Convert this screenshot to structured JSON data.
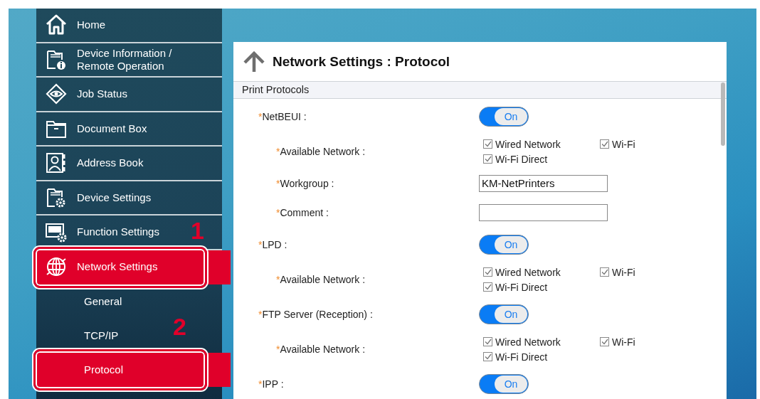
{
  "sidebar": {
    "items": [
      {
        "label": "Home",
        "selected": false,
        "callout": false
      },
      {
        "label": "Device Information / Remote Operation",
        "selected": false,
        "callout": false
      },
      {
        "label": "Job Status",
        "selected": false,
        "callout": false
      },
      {
        "label": "Document Box",
        "selected": false,
        "callout": false
      },
      {
        "label": "Address Book",
        "selected": false,
        "callout": false
      },
      {
        "label": "Device Settings",
        "selected": false,
        "callout": false
      },
      {
        "label": "Function Settings",
        "selected": false,
        "callout": false
      },
      {
        "label": "Network Settings",
        "selected": true,
        "callout": true,
        "children": [
          {
            "label": "General",
            "selected": false,
            "callout": false
          },
          {
            "label": "TCP/IP",
            "selected": false,
            "callout": false
          },
          {
            "label": "Protocol",
            "selected": true,
            "callout": true
          }
        ]
      }
    ]
  },
  "callout_numbers": [
    "1",
    "2"
  ],
  "panel": {
    "title": "Network Settings : Protocol",
    "section": "Print Protocols",
    "protocols": [
      {
        "mark": "*",
        "label": "NetBEUI :",
        "toggle": {
          "label": "On",
          "on": true
        },
        "children": [
          {
            "kind": "checkboxes",
            "mark": "*",
            "label": "Available Network :",
            "options": [
              {
                "label": "Wired Network",
                "checked": true
              },
              {
                "label": "Wi-Fi",
                "checked": true
              },
              {
                "label": "Wi-Fi Direct",
                "checked": true
              }
            ]
          },
          {
            "kind": "text",
            "mark": "*",
            "label": "Workgroup :",
            "value": "KM-NetPrinters"
          },
          {
            "kind": "text",
            "mark": "*",
            "label": "Comment :"
          }
        ]
      },
      {
        "mark": "*",
        "label": "LPD :",
        "toggle": {
          "label": "On",
          "on": true
        },
        "children": [
          {
            "kind": "checkboxes",
            "mark": "*",
            "label": "Available Network :",
            "options": [
              {
                "label": "Wired Network",
                "checked": true
              },
              {
                "label": "Wi-Fi",
                "checked": true
              },
              {
                "label": "Wi-Fi Direct",
                "checked": true
              }
            ]
          }
        ]
      },
      {
        "mark": "*",
        "label": "FTP Server (Reception) :",
        "toggle": {
          "label": "On",
          "on": true
        },
        "children": [
          {
            "kind": "checkboxes",
            "mark": "*",
            "label": "Available Network :",
            "options": [
              {
                "label": "Wired Network",
                "checked": true
              },
              {
                "label": "Wi-Fi",
                "checked": true
              },
              {
                "label": "Wi-Fi Direct",
                "checked": true
              }
            ]
          }
        ]
      },
      {
        "mark": "*",
        "label": "IPP :",
        "toggle": {
          "label": "On",
          "on": true
        }
      }
    ]
  }
}
